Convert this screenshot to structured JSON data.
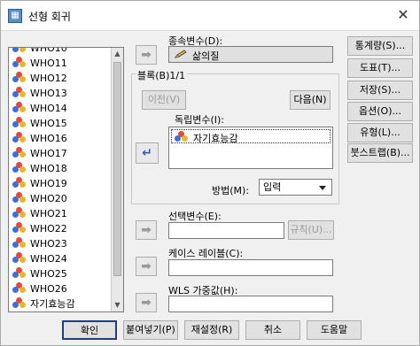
{
  "window": {
    "title": "선형 회귀",
    "app_icon": "spss-table-icon",
    "close_label": "✕"
  },
  "variables": [
    {
      "label": "WHO10"
    },
    {
      "label": "WHO11"
    },
    {
      "label": "WHO12"
    },
    {
      "label": "WHO13"
    },
    {
      "label": "WHO14"
    },
    {
      "label": "WHO15"
    },
    {
      "label": "WHO16"
    },
    {
      "label": "WHO17"
    },
    {
      "label": "WHO18"
    },
    {
      "label": "WHO19"
    },
    {
      "label": "WHO20"
    },
    {
      "label": "WHO21"
    },
    {
      "label": "WHO22"
    },
    {
      "label": "WHO23"
    },
    {
      "label": "WHO24"
    },
    {
      "label": "WHO25"
    },
    {
      "label": "WHO26"
    },
    {
      "label": "자기효능감"
    }
  ],
  "dependent": {
    "label": "종속변수(D):",
    "value": "삶의질"
  },
  "block": {
    "label": "블록(B)1/1",
    "prev": "이전(V)",
    "next": "다음(N)"
  },
  "independent": {
    "label": "독립변수(I):",
    "items": [
      "자기효능감"
    ]
  },
  "method": {
    "label": "방법(M):",
    "value": "입력"
  },
  "selection": {
    "label": "선택변수(E):",
    "rule_button": "규칙(U)..."
  },
  "case_label": {
    "label": "케이스 레이블(C):"
  },
  "wls": {
    "label": "WLS 가중값(H):"
  },
  "side_buttons": [
    "통계량(S)...",
    "도표(T)...",
    "저장(S)...",
    "옵션(O)...",
    "유형(L)...",
    "붓스트랩(B)..."
  ],
  "bottom_buttons": [
    "확인",
    "붙여넣기(P)",
    "재설정(R)",
    "취소",
    "도움말"
  ],
  "colors": {
    "accent": "#2c5fb0",
    "disabled": "#9a9a9a"
  }
}
